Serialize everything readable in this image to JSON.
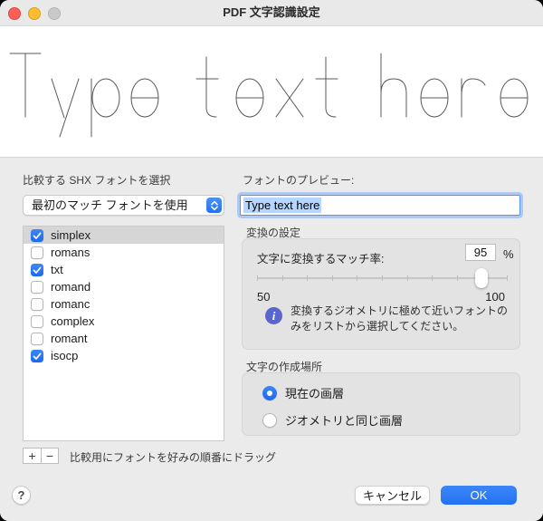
{
  "window": {
    "title": "PDF 文字認識設定"
  },
  "preview": {
    "text": "Type text here"
  },
  "left_panel": {
    "label": "比較する SHX フォントを選択",
    "dropdown_selected": "最初のマッチ フォントを使用",
    "fonts": [
      {
        "name": "simplex",
        "checked": true,
        "selected": true
      },
      {
        "name": "romans",
        "checked": false,
        "selected": false
      },
      {
        "name": "txt",
        "checked": true,
        "selected": false
      },
      {
        "name": "romand",
        "checked": false,
        "selected": false
      },
      {
        "name": "romanc",
        "checked": false,
        "selected": false
      },
      {
        "name": "complex",
        "checked": false,
        "selected": false
      },
      {
        "name": "romant",
        "checked": false,
        "selected": false
      },
      {
        "name": "isocp",
        "checked": true,
        "selected": false
      }
    ],
    "add_label": "+",
    "remove_label": "−",
    "hint": "比較用にフォントを好みの順番にドラッグ"
  },
  "right_panel": {
    "preview_label": "フォントのプレビュー:",
    "preview_value": "Type text here",
    "conversion": {
      "section_label": "変換の設定",
      "match_label": "文字に変換するマッチ率:",
      "match_value": "95",
      "percent_label": "%",
      "slider": {
        "min": 50,
        "max": 100,
        "value": 95,
        "min_label": "50",
        "max_label": "100",
        "ticks": 11
      },
      "info_glyph": "i",
      "info_text": "変換するジオメトリに極めて近いフォントのみをリストから選択してください。"
    },
    "placement": {
      "section_label": "文字の作成場所",
      "options": [
        {
          "label": "現在の画層",
          "selected": true
        },
        {
          "label": "ジオメトリと同じ画層",
          "selected": false
        }
      ]
    }
  },
  "footer": {
    "help_label": "?",
    "cancel_label": "キャンセル",
    "ok_label": "OK"
  },
  "colors": {
    "accent_blue": "#2779f4",
    "info_icon_blue": "#5a66cf",
    "selection_highlight": "#b5d7ff",
    "traffic_red": "#ff5f57",
    "traffic_yellow": "#febc2e",
    "traffic_gray": "#c9c9c7"
  }
}
